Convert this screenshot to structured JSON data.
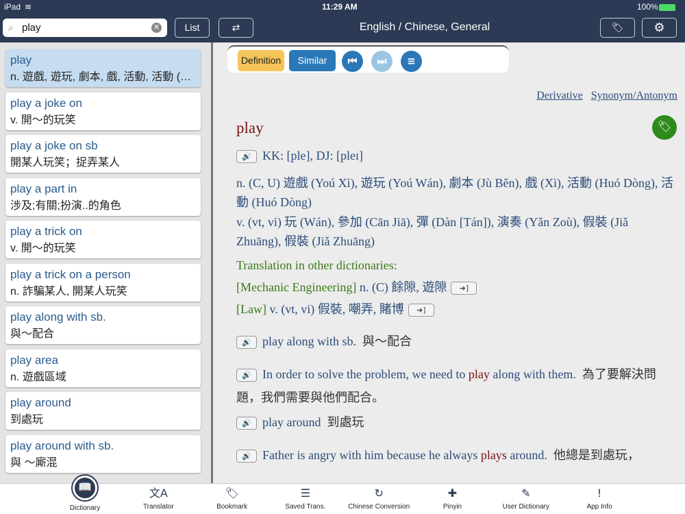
{
  "status": {
    "device": "iPad",
    "time": "11:29 AM",
    "battery": "100%"
  },
  "header": {
    "search_value": "play",
    "list_label": "List",
    "title": "English / Chinese, General"
  },
  "list": [
    {
      "word": "play",
      "def": "n. 遊戲, 遊玩, 劇本, 戲, 活動, 活動 (Huó Dòng)"
    },
    {
      "word": "play a joke on",
      "def": "v. 開～的玩笑"
    },
    {
      "word": "play a joke on sb",
      "def": "開某人玩笑；捉弄某人"
    },
    {
      "word": "play a part in",
      "def": "涉及;有關;扮演..的角色"
    },
    {
      "word": "play a trick on",
      "def": "v. 開～的玩笑"
    },
    {
      "word": "play a trick on a person",
      "def": "n. 詐騙某人, 開某人玩笑"
    },
    {
      "word": "play along with sb.",
      "def": "與～配合"
    },
    {
      "word": "play area",
      "def": "n. 遊戲區域"
    },
    {
      "word": "play around",
      "def": "到處玩"
    },
    {
      "word": "play around with sb.",
      "def": "與 ～廝混"
    }
  ],
  "toolbar": {
    "definition": "Definition",
    "similar": "Similar"
  },
  "links": {
    "derivative": "Derivative",
    "synonym": "Synonym/Antonym"
  },
  "entry": {
    "headword": "play",
    "pron": "KK: [ple], DJ: [pleɪ]",
    "noun": "n. (C, U)  遊戲 (Yoú Xì), 遊玩 (Yoú Wán), 劇本 (Jù Běn), 戲 (Xì), 活動 (Huó Dòng), 活動 (Huó Dòng)",
    "verb": "v. (vt, vi)  玩 (Wán), 參加 (Cān Jiā), 彈 (Dàn [Tán]), 演奏 (Yǎn Zoù), 假裝 (Jiǎ Zhuāng), 假裝 (Jiǎ Zhuāng)",
    "other_heading": "Translation in other dictionaries:",
    "other": [
      {
        "field": "[Mechanic Engineering]",
        "text": " n. (C) 餘隙, 遊隙"
      },
      {
        "field": "[Law]",
        "text": " v. (vt, vi) 假裝, 嘲弄, 賭博"
      }
    ],
    "examples": [
      {
        "before": "play along with sb.",
        "hl": "",
        "after": "",
        "zh": "與～配合"
      },
      {
        "before": "In order to solve the problem, we need to ",
        "hl": "play",
        "after": " along with them.",
        "zh": "為了要解決問題，我們需要與他們配合。"
      },
      {
        "before": "play around",
        "hl": "",
        "after": "",
        "zh": "到處玩"
      },
      {
        "before": "Father is angry with him because he always ",
        "hl": "plays",
        "after": " around.",
        "zh": "他總是到處玩，"
      }
    ]
  },
  "tabs": [
    {
      "label": "Dictionary",
      "icon": "📖"
    },
    {
      "label": "Translator",
      "icon": "文A"
    },
    {
      "label": "Bookmark",
      "icon": "🏷"
    },
    {
      "label": "Saved Trans.",
      "icon": "☰"
    },
    {
      "label": "Chinese Conversion",
      "icon": "↻"
    },
    {
      "label": "Pinyin",
      "icon": "✚"
    },
    {
      "label": "User Dictionary",
      "icon": "✎"
    },
    {
      "label": "App Info",
      "icon": "!"
    }
  ]
}
